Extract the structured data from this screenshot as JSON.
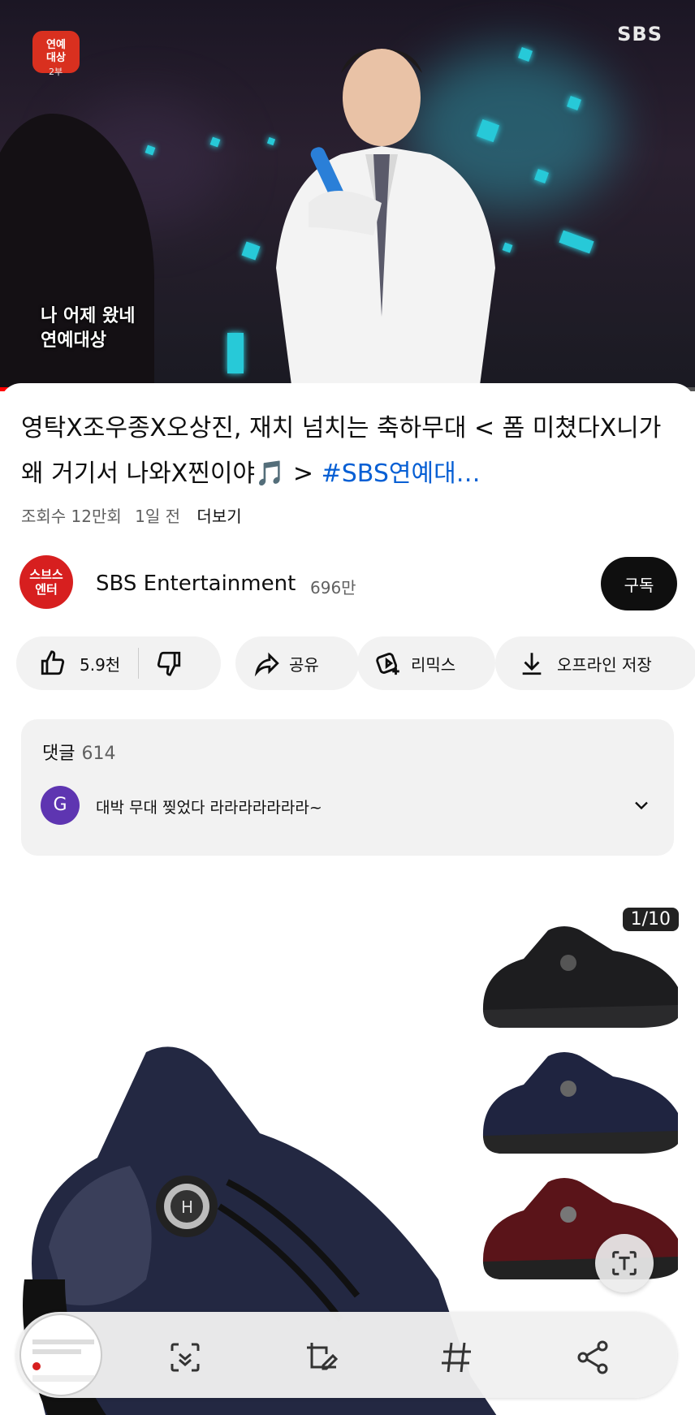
{
  "video": {
    "watermark": "SBS",
    "badge_text": "연예\n대상",
    "badge_part": "2부",
    "caption": "나 어제 왔네\n연예대상",
    "progress_fraction": 0.06
  },
  "title": {
    "text": "영탁X조우종X오상진, 재치 넘치는  축하무대 < 폼 미쳤다X니가 왜 거기서 나와X찐이야🎵 > ",
    "hashtag": "#SBS연예대…"
  },
  "meta": {
    "views": "조회수 12만회",
    "age": "1일 전",
    "more": "더보기"
  },
  "channel": {
    "avatar_text": "스브스\n엔터",
    "name": "SBS Entertainment",
    "subscribers": "696만",
    "subscribe_label": "구독"
  },
  "actions": {
    "likes": "5.9천",
    "share": "공유",
    "remix": "리믹스",
    "download": "오프라인 저장"
  },
  "comments": {
    "label": "댓글",
    "count": "614",
    "avatar_letter": "G",
    "top_comment": "대박 무대 찢었다 라라라라라라라~"
  },
  "product": {
    "page_indicator": "1/10"
  },
  "colors": {
    "accent_link": "#065fd4",
    "progress_red": "#ff0000",
    "subscribe_bg": "#0f0f0f",
    "comment_avatar": "#5e35b1",
    "channel_avatar": "#d71f1f"
  },
  "icons": {
    "like": "thumb-up-icon",
    "dislike": "thumb-down-icon",
    "share": "share-arrow-icon",
    "remix": "remix-icon",
    "download": "download-icon",
    "chevron": "chevron-down-icon",
    "text_fab": "text-extract-icon",
    "toolbar": [
      "scan-icon",
      "edit-crop-icon",
      "hashtag-icon",
      "share-icon"
    ]
  }
}
